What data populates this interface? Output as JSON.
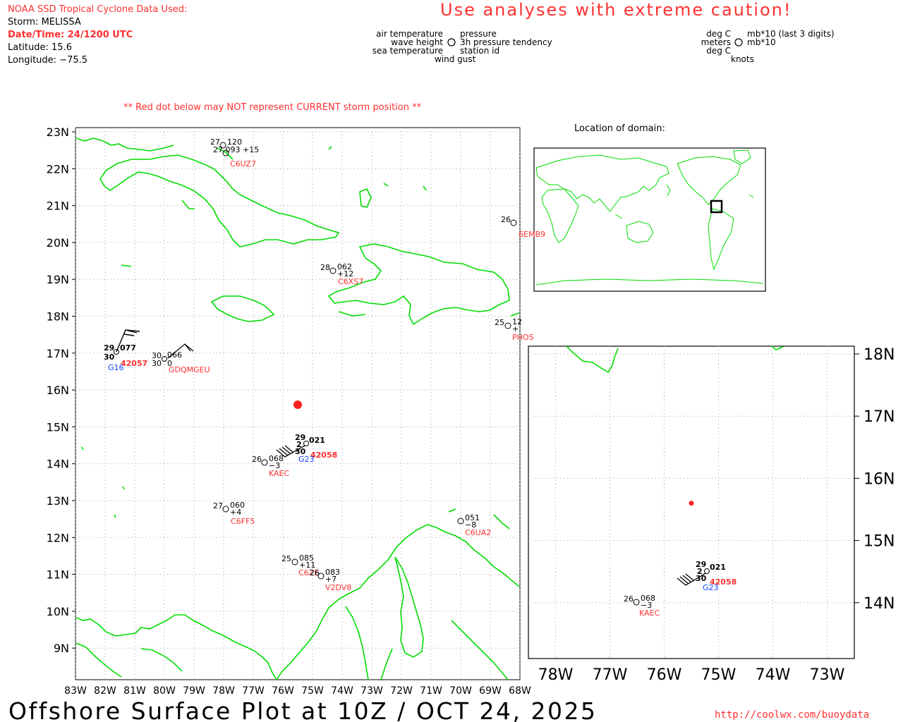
{
  "header": {
    "source": "NOAA SSD Tropical Cyclone Data Used:",
    "storm_line": "Storm: MELISSA",
    "datetime_line": "Date/Time: 24/1200 UTC",
    "latitude_line": "Latitude: 15.6",
    "longitude_line": "Longitude: −75.5",
    "caution": "Use analyses with extreme caution!",
    "red_dot_note": "** Red dot below may NOT represent CURRENT storm position **"
  },
  "legend": {
    "left": {
      "air_temperature": "air temperature",
      "wave_height": "wave height",
      "sea_temperature": "sea temperature",
      "pressure": "pressure",
      "tendency": "3h pressure tendency",
      "station_id": "station id",
      "wind_gust": "wind gust"
    },
    "right": {
      "deg_c_top": "deg C",
      "meters": "meters",
      "deg_c_bottom": "deg C",
      "mb_last3": "mb*10 (last 3 digits)",
      "mb10": "mb*10",
      "knots": "knots"
    }
  },
  "location_title": "Location of domain:",
  "main_map": {
    "lat_labels": [
      "23N",
      "22N",
      "21N",
      "20N",
      "19N",
      "18N",
      "17N",
      "16N",
      "15N",
      "14N",
      "13N",
      "12N",
      "11N",
      "10N",
      "9N"
    ],
    "lon_labels": [
      "83W",
      "82W",
      "81W",
      "80W",
      "79W",
      "78W",
      "77W",
      "76W",
      "75W",
      "74W",
      "73W",
      "72W",
      "71W",
      "70W",
      "69W",
      "68W"
    ],
    "storm": {
      "lat": 15.6,
      "lon": -75.5
    },
    "stations": [
      {
        "id": "C6UZ7",
        "lat": 22.4,
        "lon": -77.9,
        "air": "27",
        "pressure": "120",
        "sea": "",
        "tendency": "",
        "extra": "27 093  +15"
      },
      {
        "id": "6EMB9",
        "lat": 20.5,
        "lon": -68.2,
        "air": "26",
        "pressure": "",
        "sea": "",
        "tendency": ""
      },
      {
        "id": "C6XS7",
        "lat": 19.2,
        "lon": -74.4,
        "air": "28",
        "pressure": "062",
        "sea": "",
        "tendency": "+12"
      },
      {
        "id": "PHOS",
        "lat": 17.7,
        "lon": -68.4,
        "air": "25",
        "pressure": "12",
        "sea": "",
        "tendency": "+"
      },
      {
        "id": "42057",
        "lat": 17.0,
        "lon": -81.5,
        "air": "29",
        "pressure": "077",
        "sea": "30",
        "tendency": "",
        "sub_id": "G16"
      },
      {
        "id": "GDQMGEU",
        "lat": 16.8,
        "lon": -80.0,
        "air": "30",
        "pressure": "066",
        "sea": "30",
        "tendency": "0"
      },
      {
        "id": "42058",
        "lat": 14.5,
        "lon": -75.0,
        "air": "29",
        "pressure": "021",
        "sea": "30",
        "wave": "2",
        "tendency": "",
        "sub_id": "G23"
      },
      {
        "id": "KAEC",
        "lat": 14.0,
        "lon": -76.6,
        "air": "26",
        "pressure": "068",
        "sea": "",
        "tendency": "−3"
      },
      {
        "id": "C6FF5",
        "lat": 12.7,
        "lon": -77.8,
        "air": "27",
        "pressure": "060",
        "sea": "",
        "tendency": "+4"
      },
      {
        "id": "C6UA2",
        "lat": 12.4,
        "lon": -70.0,
        "air": "",
        "pressure": "051",
        "sea": "",
        "tendency": "−8"
      },
      {
        "id": "C6ZE",
        "lat": 11.3,
        "lon": -75.6,
        "air": "25",
        "pressure": "085",
        "sea": "",
        "tendency": "+11"
      },
      {
        "id": "V2DV8",
        "lat": 10.9,
        "lon": -74.7,
        "air": "",
        "pressure": "083",
        "sea": "",
        "tendency": "+7",
        "extra": "26"
      }
    ]
  },
  "inset_map": {
    "lat_labels": [
      "18N",
      "17N",
      "16N",
      "15N",
      "14N"
    ],
    "lon_labels": [
      "78W",
      "77W",
      "76W",
      "75W",
      "74W",
      "73W"
    ],
    "storm": {
      "lat": 15.6,
      "lon": -75.5
    },
    "stations": [
      {
        "id": "42058",
        "air": "29",
        "wave": "2",
        "sea": "30",
        "pressure": "021",
        "sub_id": "G23"
      },
      {
        "id": "KAEC",
        "air": "26",
        "pressure": "068",
        "tendency": "−3"
      }
    ]
  },
  "footer": {
    "plot_title": "Offshore Surface Plot at 10Z / OCT 24, 2025",
    "url": "http://coolwx.com/buoydata"
  },
  "colors": {
    "coast": "#00dd00",
    "text_red": "#ff3030",
    "station_red": "#ff3030",
    "id_blue": "#1040ff",
    "grid": "#a0a0a0",
    "storm_dot": "#ff2020"
  }
}
